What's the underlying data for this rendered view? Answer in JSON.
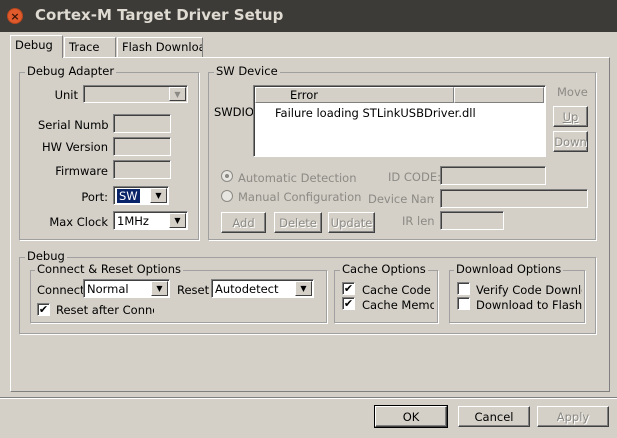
{
  "window": {
    "title": "Cortex-M Target Driver Setup"
  },
  "tabs": [
    {
      "label": "Debug",
      "active": true
    },
    {
      "label": "Trace",
      "active": false
    },
    {
      "label": "Flash Download",
      "active": false
    }
  ],
  "debug_adapter": {
    "title": "Debug Adapter",
    "unit_label": "Unit",
    "unit_value": "",
    "serial_label": "Serial Number",
    "serial_value": "",
    "hw_label": "HW Version",
    "hw_value": "",
    "fw_label": "Firmware",
    "fw_value": "",
    "port_label": "Port:",
    "port_value": "SW",
    "clock_label": "Max Clock",
    "clock_value": "1MHz"
  },
  "sw_device": {
    "title": "SW Device",
    "swdio_label": "SWDIO",
    "move_label": "Move",
    "up_label": "Up",
    "down_label": "Down",
    "col_error": "Error",
    "rows": [
      {
        "error": "Failure loading STLinkUSBDriver.dll"
      }
    ],
    "auto_detect_label": "Automatic Detection",
    "manual_config_label": "Manual Configuration",
    "id_code_label": "ID CODE:",
    "device_name_label": "Device Name",
    "ir_len_label": "IR len",
    "id_code_value": "",
    "device_name_value": "",
    "ir_len_value": "",
    "add_label": "Add",
    "delete_label": "Delete",
    "update_label": "Update"
  },
  "debug": {
    "title": "Debug",
    "connect_reset_title": "Connect & Reset Options",
    "connect_label": "Connect",
    "connect_value": "Normal",
    "reset_label": "Reset",
    "reset_value": "Autodetect",
    "reset_after_connect_label": "Reset after Connect",
    "reset_after_connect_checked": true,
    "cache_title": "Cache Options",
    "cache_code_label": "Cache Code",
    "cache_code_checked": true,
    "cache_memory_label": "Cache Memory",
    "cache_memory_checked": true,
    "download_title": "Download Options",
    "verify_label": "Verify Code Download",
    "verify_checked": false,
    "download_flash_label": "Download to Flash",
    "download_flash_checked": false
  },
  "footer": {
    "ok_label": "OK",
    "cancel_label": "Cancel",
    "apply_label": "Apply"
  },
  "icons": {
    "close": "×",
    "check": "✔",
    "arrow_down": "▼"
  }
}
